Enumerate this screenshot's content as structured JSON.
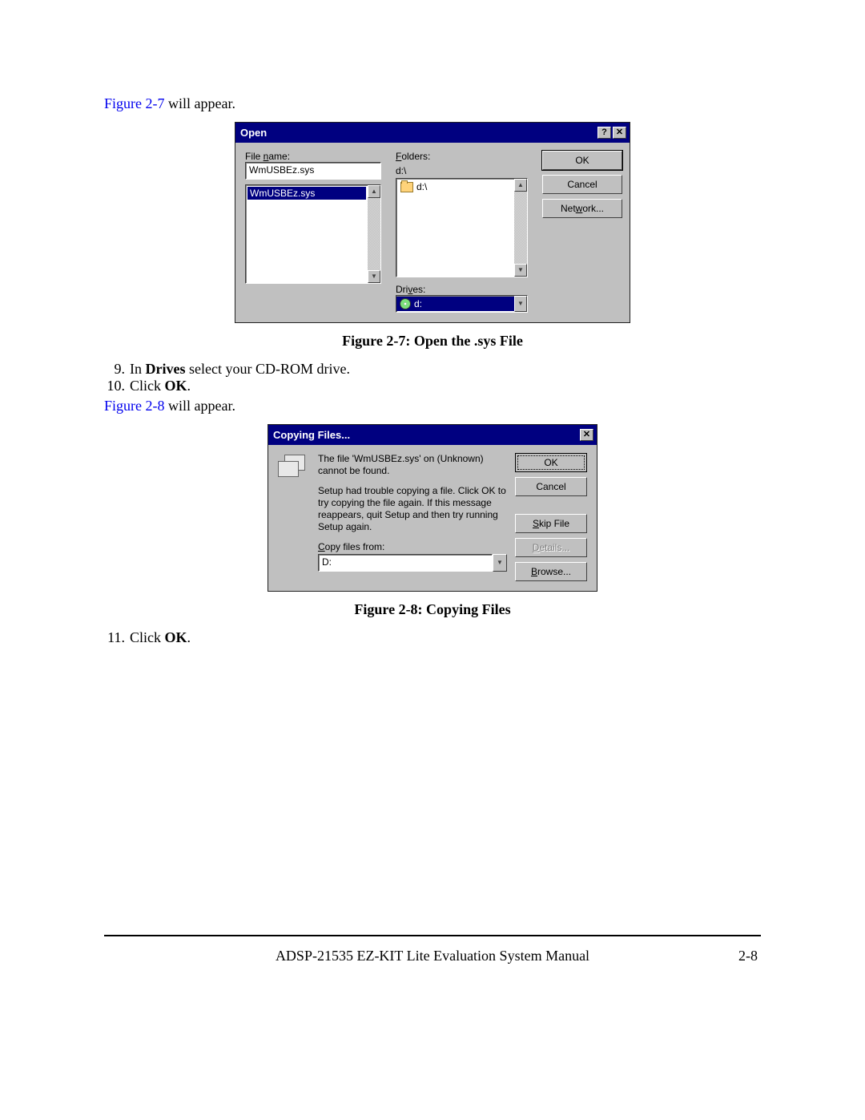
{
  "intro_link": "Figure 2-7",
  "intro_rest": " will appear.",
  "open_dialog": {
    "title": "Open",
    "help_glyph": "?",
    "close_glyph": "✕",
    "file_name_label_pre": "File ",
    "file_name_label_u": "n",
    "file_name_label_post": "ame:",
    "file_name_value": "WmUSBEz.sys",
    "list_items": [
      "WmUSBEz.sys"
    ],
    "folders_label_u": "F",
    "folders_label_post": "olders:",
    "folders_path": "d:\\",
    "folder_tree_item": "d:\\",
    "drives_label_pre": "Dri",
    "drives_label_u": "v",
    "drives_label_post": "es:",
    "drives_value": "d:",
    "buttons": {
      "ok": "OK",
      "cancel": "Cancel",
      "network_pre": "Net",
      "network_u": "w",
      "network_post": "ork..."
    }
  },
  "caption1": "Figure 2-7: Open the .sys File",
  "steps_a": [
    {
      "num": "9.",
      "pre": "In ",
      "bold": "Drives",
      "post": " select your CD-ROM drive."
    },
    {
      "num": "10.",
      "pre": "Click ",
      "bold": "OK",
      "post": "."
    }
  ],
  "mid_link": "Figure 2-8",
  "mid_rest": " will appear.",
  "copy_dialog": {
    "title": "Copying Files...",
    "close_glyph": "✕",
    "msg1": "The file 'WmUSBEz.sys' on (Unknown) cannot be found.",
    "msg2": "Setup had trouble copying a file. Click OK to try copying the file again. If this message reappears, quit Setup and then try running Setup again.",
    "copy_from_label_u": "C",
    "copy_from_label_post": "opy files from:",
    "copy_from_value": "D:",
    "buttons": {
      "ok": "OK",
      "cancel": "Cancel",
      "skip_u": "S",
      "skip_post": "kip File",
      "details_u": "D",
      "details_post": "etails...",
      "browse_u": "B",
      "browse_post": "rowse..."
    }
  },
  "caption2": "Figure 2-8: Copying Files",
  "steps_b": [
    {
      "num": "11.",
      "pre": "Click ",
      "bold": "OK",
      "post": "."
    }
  ],
  "footer_title": "ADSP-21535 EZ-KIT Lite Evaluation System Manual",
  "footer_page": "2-8"
}
